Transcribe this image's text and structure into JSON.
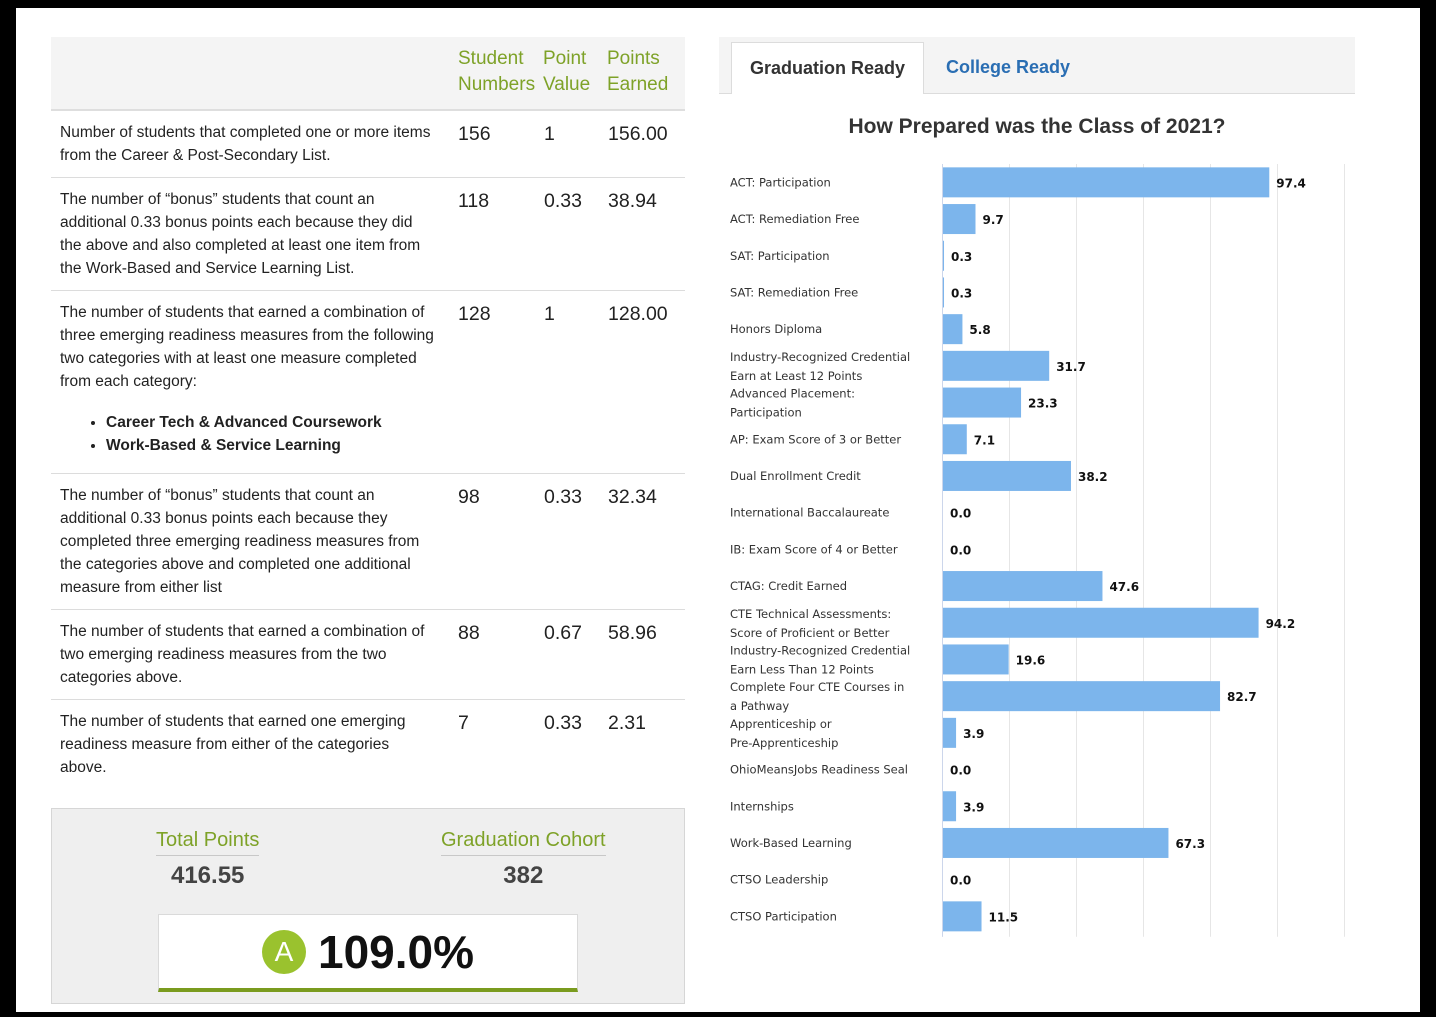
{
  "table": {
    "headers": {
      "student_numbers": [
        "Student",
        "Numbers"
      ],
      "point_value": [
        "Point",
        "Value"
      ],
      "points_earned": [
        "Points",
        "Earned"
      ]
    },
    "rows": [
      {
        "desc": "Number of students that completed one or more items from the Career & Post-Secondary List.",
        "students": "156",
        "value": "1",
        "earned": "156.00"
      },
      {
        "desc": "The number of “bonus” students that count an additional 0.33 bonus points each because they did the above and also completed at least one item from the Work-Based and Service Learning List.",
        "students": "118",
        "value": "0.33",
        "earned": "38.94"
      },
      {
        "desc": "The number of students that earned a combination of three emerging readiness measures from the following two categories with at least one measure completed from each category:",
        "bullets": [
          "Career Tech & Advanced Coursework",
          "Work-Based & Service Learning"
        ],
        "students": "128",
        "value": "1",
        "earned": "128.00"
      },
      {
        "desc": "The number of “bonus” students that count an additional 0.33 bonus points each because they completed three emerging readiness measures from the categories above and completed one additional measure from either list",
        "students": "98",
        "value": "0.33",
        "earned": "32.34"
      },
      {
        "desc": "The number of students that earned a combination of two emerging readiness measures from the two categories above.",
        "students": "88",
        "value": "0.67",
        "earned": "58.96"
      },
      {
        "desc": "The number of students that earned one emerging readiness measure from either of the categories above.",
        "students": "7",
        "value": "0.33",
        "earned": "2.31"
      }
    ]
  },
  "summary": {
    "total_points_label": "Total Points",
    "total_points": "416.55",
    "cohort_label": "Graduation Cohort",
    "cohort": "382",
    "grade_letter": "A",
    "grade_percent": "109.0%",
    "grade_color": "#9ac22e"
  },
  "tabs": {
    "graduation_ready": "Graduation Ready",
    "college_ready": "College Ready",
    "active": "Graduation Ready"
  },
  "chart_title": "How Prepared was the Class of 2021?",
  "chart_data": {
    "type": "bar",
    "orientation": "horizontal",
    "title": "How Prepared was the Class of 2021?",
    "bar_color": "#7cb5ec",
    "xlim": [
      0,
      120
    ],
    "grid": true,
    "categories": [
      [
        "ACT: Participation"
      ],
      [
        "ACT: Remediation Free"
      ],
      [
        "SAT: Participation"
      ],
      [
        "SAT: Remediation Free"
      ],
      [
        "Honors Diploma"
      ],
      [
        "Industry-Recognized Credential",
        "Earn at Least 12 Points"
      ],
      [
        "Advanced Placement:",
        "Participation"
      ],
      [
        "AP: Exam Score of 3 or Better"
      ],
      [
        "Dual Enrollment Credit"
      ],
      [
        "International Baccalaureate"
      ],
      [
        "IB: Exam Score of 4 or Better"
      ],
      [
        "CTAG: Credit Earned"
      ],
      [
        "CTE Technical Assessments:",
        "Score of Proficient or Better"
      ],
      [
        "Industry-Recognized Credential",
        "Earn Less Than 12 Points"
      ],
      [
        "Complete Four CTE Courses in",
        "a Pathway"
      ],
      [
        "Apprenticeship or",
        "Pre-Apprenticeship"
      ],
      [
        "OhioMeansJobs Readiness Seal"
      ],
      [
        "Internships"
      ],
      [
        "Work-Based Learning"
      ],
      [
        "CTSO Leadership"
      ],
      [
        "CTSO Participation"
      ]
    ],
    "values": [
      97.4,
      9.7,
      0.3,
      0.3,
      5.8,
      31.7,
      23.3,
      7.1,
      38.2,
      0.0,
      0.0,
      47.6,
      94.2,
      19.6,
      82.7,
      3.9,
      0.0,
      3.9,
      67.3,
      0.0,
      11.5
    ],
    "value_labels": [
      "97.4",
      "9.7",
      "0.3",
      "0.3",
      "5.8",
      "31.7",
      "23.3",
      "7.1",
      "38.2",
      "0.0",
      "0.0",
      "47.6",
      "94.2",
      "19.6",
      "82.7",
      "3.9",
      "0.0",
      "3.9",
      "67.3",
      "0.0",
      "11.5"
    ]
  }
}
